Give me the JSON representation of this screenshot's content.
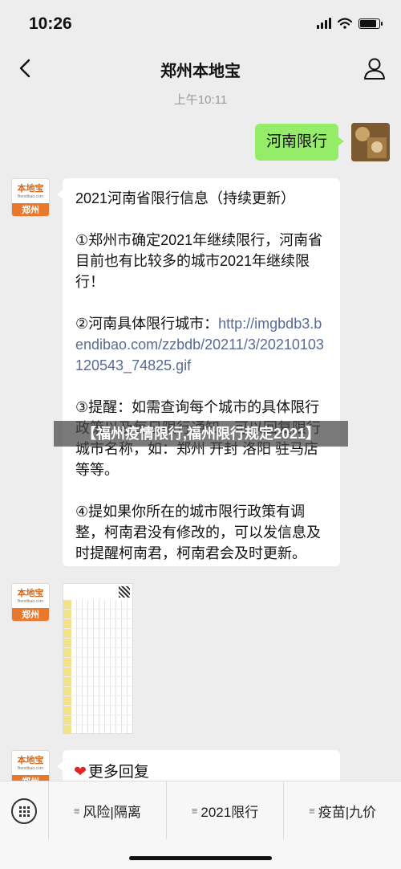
{
  "status": {
    "time": "10:26",
    "battery_level": 0.85
  },
  "nav": {
    "title": "郑州本地宝"
  },
  "chat": {
    "timestamp": "上午10:11",
    "outgoing_message": "河南限行",
    "bot_logo_name": "本地宝",
    "bot_logo_url": "Bendibao.com",
    "bot_logo_city": "郑州",
    "info": {
      "title": "2021河南省限行信息（持续更新）",
      "item1": "①郑州市确定2021年继续限行，河南省目前也有比较多的城市2021年继续限行！",
      "item2_prefix": "②河南具体限行城市：",
      "item2_link": "http://imgbdb3.bendibao.com/zzbdb/20211/3/20210103120543_74825.gif",
      "item3": "③提醒：如需查询每个城市的具体限行政策以及每日限行通知，可以回复限行城市名称，如：郑州 开封 洛阳 驻马店 等等。",
      "item4": "④提如果你所在的城市限行政策有调整，柯南君没有修改的，可以发信息及时提醒柯南君，柯南君会及时更新。"
    },
    "more_label": "更多回复"
  },
  "overlay_caption": "【福州疫情限行,福州限行规定2021】",
  "bottom_menu": [
    {
      "label": "风险|隔离"
    },
    {
      "label": "2021限行"
    },
    {
      "label": "疫苗|九价"
    }
  ],
  "colors": {
    "outgoing_bubble": "#95ec69",
    "link": "#576b95",
    "background": "#ededed",
    "brand_orange": "#e8792c"
  }
}
